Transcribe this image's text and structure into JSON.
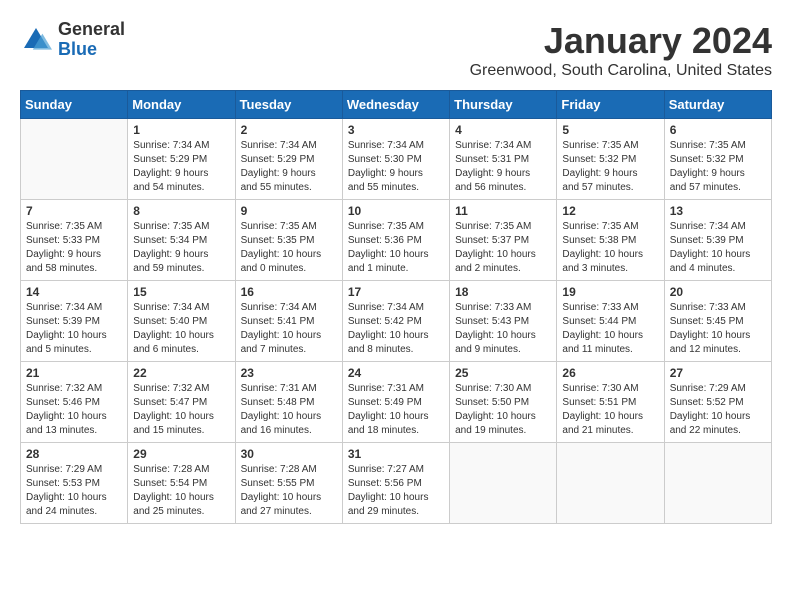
{
  "logo": {
    "general": "General",
    "blue": "Blue"
  },
  "title": "January 2024",
  "location": "Greenwood, South Carolina, United States",
  "days_of_week": [
    "Sunday",
    "Monday",
    "Tuesday",
    "Wednesday",
    "Thursday",
    "Friday",
    "Saturday"
  ],
  "weeks": [
    [
      {
        "day": "",
        "info": ""
      },
      {
        "day": "1",
        "info": "Sunrise: 7:34 AM\nSunset: 5:29 PM\nDaylight: 9 hours\nand 54 minutes."
      },
      {
        "day": "2",
        "info": "Sunrise: 7:34 AM\nSunset: 5:29 PM\nDaylight: 9 hours\nand 55 minutes."
      },
      {
        "day": "3",
        "info": "Sunrise: 7:34 AM\nSunset: 5:30 PM\nDaylight: 9 hours\nand 55 minutes."
      },
      {
        "day": "4",
        "info": "Sunrise: 7:34 AM\nSunset: 5:31 PM\nDaylight: 9 hours\nand 56 minutes."
      },
      {
        "day": "5",
        "info": "Sunrise: 7:35 AM\nSunset: 5:32 PM\nDaylight: 9 hours\nand 57 minutes."
      },
      {
        "day": "6",
        "info": "Sunrise: 7:35 AM\nSunset: 5:32 PM\nDaylight: 9 hours\nand 57 minutes."
      }
    ],
    [
      {
        "day": "7",
        "info": "Sunrise: 7:35 AM\nSunset: 5:33 PM\nDaylight: 9 hours\nand 58 minutes."
      },
      {
        "day": "8",
        "info": "Sunrise: 7:35 AM\nSunset: 5:34 PM\nDaylight: 9 hours\nand 59 minutes."
      },
      {
        "day": "9",
        "info": "Sunrise: 7:35 AM\nSunset: 5:35 PM\nDaylight: 10 hours\nand 0 minutes."
      },
      {
        "day": "10",
        "info": "Sunrise: 7:35 AM\nSunset: 5:36 PM\nDaylight: 10 hours\nand 1 minute."
      },
      {
        "day": "11",
        "info": "Sunrise: 7:35 AM\nSunset: 5:37 PM\nDaylight: 10 hours\nand 2 minutes."
      },
      {
        "day": "12",
        "info": "Sunrise: 7:35 AM\nSunset: 5:38 PM\nDaylight: 10 hours\nand 3 minutes."
      },
      {
        "day": "13",
        "info": "Sunrise: 7:34 AM\nSunset: 5:39 PM\nDaylight: 10 hours\nand 4 minutes."
      }
    ],
    [
      {
        "day": "14",
        "info": "Sunrise: 7:34 AM\nSunset: 5:39 PM\nDaylight: 10 hours\nand 5 minutes."
      },
      {
        "day": "15",
        "info": "Sunrise: 7:34 AM\nSunset: 5:40 PM\nDaylight: 10 hours\nand 6 minutes."
      },
      {
        "day": "16",
        "info": "Sunrise: 7:34 AM\nSunset: 5:41 PM\nDaylight: 10 hours\nand 7 minutes."
      },
      {
        "day": "17",
        "info": "Sunrise: 7:34 AM\nSunset: 5:42 PM\nDaylight: 10 hours\nand 8 minutes."
      },
      {
        "day": "18",
        "info": "Sunrise: 7:33 AM\nSunset: 5:43 PM\nDaylight: 10 hours\nand 9 minutes."
      },
      {
        "day": "19",
        "info": "Sunrise: 7:33 AM\nSunset: 5:44 PM\nDaylight: 10 hours\nand 11 minutes."
      },
      {
        "day": "20",
        "info": "Sunrise: 7:33 AM\nSunset: 5:45 PM\nDaylight: 10 hours\nand 12 minutes."
      }
    ],
    [
      {
        "day": "21",
        "info": "Sunrise: 7:32 AM\nSunset: 5:46 PM\nDaylight: 10 hours\nand 13 minutes."
      },
      {
        "day": "22",
        "info": "Sunrise: 7:32 AM\nSunset: 5:47 PM\nDaylight: 10 hours\nand 15 minutes."
      },
      {
        "day": "23",
        "info": "Sunrise: 7:31 AM\nSunset: 5:48 PM\nDaylight: 10 hours\nand 16 minutes."
      },
      {
        "day": "24",
        "info": "Sunrise: 7:31 AM\nSunset: 5:49 PM\nDaylight: 10 hours\nand 18 minutes."
      },
      {
        "day": "25",
        "info": "Sunrise: 7:30 AM\nSunset: 5:50 PM\nDaylight: 10 hours\nand 19 minutes."
      },
      {
        "day": "26",
        "info": "Sunrise: 7:30 AM\nSunset: 5:51 PM\nDaylight: 10 hours\nand 21 minutes."
      },
      {
        "day": "27",
        "info": "Sunrise: 7:29 AM\nSunset: 5:52 PM\nDaylight: 10 hours\nand 22 minutes."
      }
    ],
    [
      {
        "day": "28",
        "info": "Sunrise: 7:29 AM\nSunset: 5:53 PM\nDaylight: 10 hours\nand 24 minutes."
      },
      {
        "day": "29",
        "info": "Sunrise: 7:28 AM\nSunset: 5:54 PM\nDaylight: 10 hours\nand 25 minutes."
      },
      {
        "day": "30",
        "info": "Sunrise: 7:28 AM\nSunset: 5:55 PM\nDaylight: 10 hours\nand 27 minutes."
      },
      {
        "day": "31",
        "info": "Sunrise: 7:27 AM\nSunset: 5:56 PM\nDaylight: 10 hours\nand 29 minutes."
      },
      {
        "day": "",
        "info": ""
      },
      {
        "day": "",
        "info": ""
      },
      {
        "day": "",
        "info": ""
      }
    ]
  ]
}
